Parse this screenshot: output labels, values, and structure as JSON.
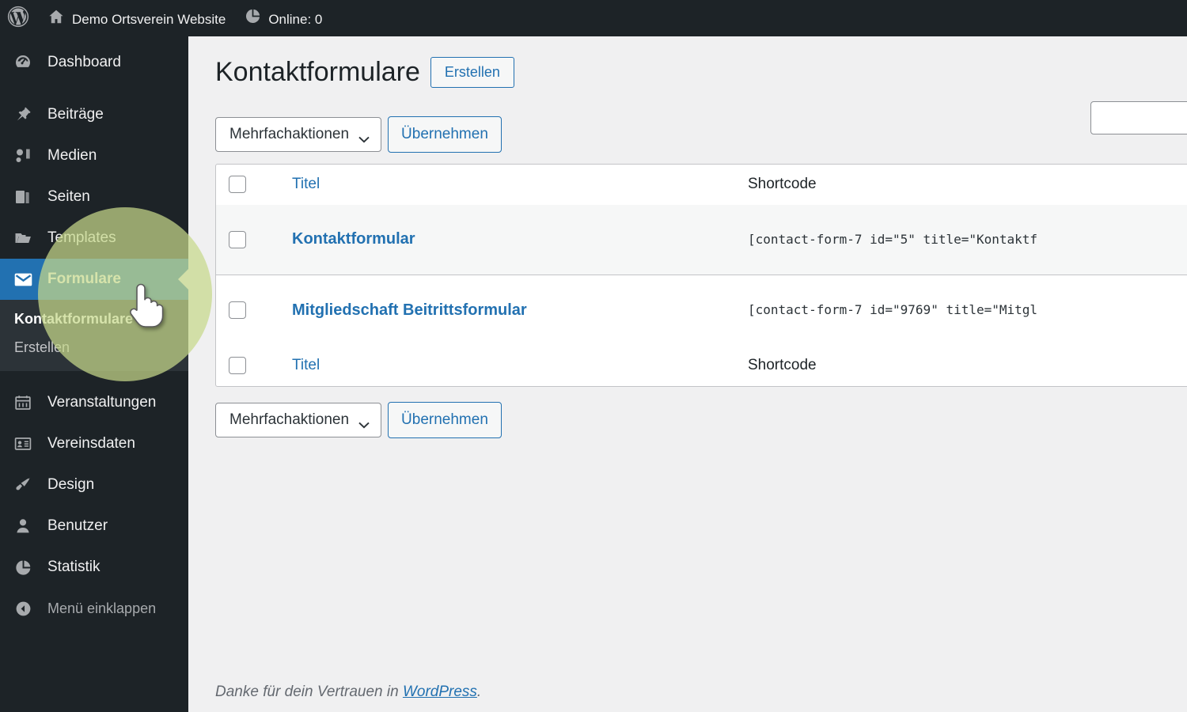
{
  "adminbar": {
    "logo_icon": "wordpress-logo-icon",
    "site_icon": "home-icon",
    "site_name": "Demo Ortsverein Website",
    "online_icon": "pie-chart-icon",
    "online_label": "Online: 0"
  },
  "sidebar": {
    "items": [
      {
        "label": "Dashboard",
        "icon": "dashboard-icon",
        "state": "normal"
      },
      {
        "label": "Beiträge",
        "icon": "pin-icon",
        "state": "normal"
      },
      {
        "label": "Medien",
        "icon": "media-icon",
        "state": "normal"
      },
      {
        "label": "Seiten",
        "icon": "pages-icon",
        "state": "normal"
      },
      {
        "label": "Templates",
        "icon": "folder-icon",
        "state": "normal"
      },
      {
        "label": "Formulare",
        "icon": "mail-icon",
        "state": "current"
      },
      {
        "label": "Veranstaltungen",
        "icon": "calendar-icon",
        "state": "normal"
      },
      {
        "label": "Vereinsdaten",
        "icon": "id-card-icon",
        "state": "normal"
      },
      {
        "label": "Design",
        "icon": "paintbrush-icon",
        "state": "normal"
      },
      {
        "label": "Benutzer",
        "icon": "user-icon",
        "state": "normal"
      },
      {
        "label": "Statistik",
        "icon": "pie-chart-icon",
        "state": "normal"
      },
      {
        "label": "Menü einklappen",
        "icon": "collapse-arrow-icon",
        "state": "dim"
      }
    ],
    "submenu": [
      {
        "label": "Kontaktformulare",
        "current": true
      },
      {
        "label": "Erstellen",
        "current": false
      }
    ]
  },
  "header": {
    "title": "Kontaktformulare",
    "add_button": "Erstellen"
  },
  "search": {
    "value": "",
    "placeholder": ""
  },
  "tablenav": {
    "bulk_label": "Mehrfachaktionen",
    "apply_label": "Übernehmen",
    "chevron_icon": "chevron-down-icon"
  },
  "table": {
    "columns": {
      "title": "Titel",
      "shortcode": "Shortcode"
    },
    "rows": [
      {
        "title": "Kontaktformular",
        "shortcode": "[contact-form-7 id=\"5\" title=\"Kontaktf"
      },
      {
        "title": "Mitgliedschaft Beitrittsformular",
        "shortcode": "[contact-form-7 id=\"9769\" title=\"Mitgl"
      }
    ]
  },
  "footer": {
    "thanks_prefix": "Danke für dein Vertrauen in ",
    "link_label": "WordPress",
    "suffix": "."
  },
  "colors": {
    "admin_bar": "#1d2327",
    "sidebar": "#1d2327",
    "current_menu": "#2271b1",
    "submenu_bg": "#2c3338",
    "link": "#2271b1",
    "content_bg": "#f0f0f1",
    "highlight_circle": "#c6d88a"
  }
}
